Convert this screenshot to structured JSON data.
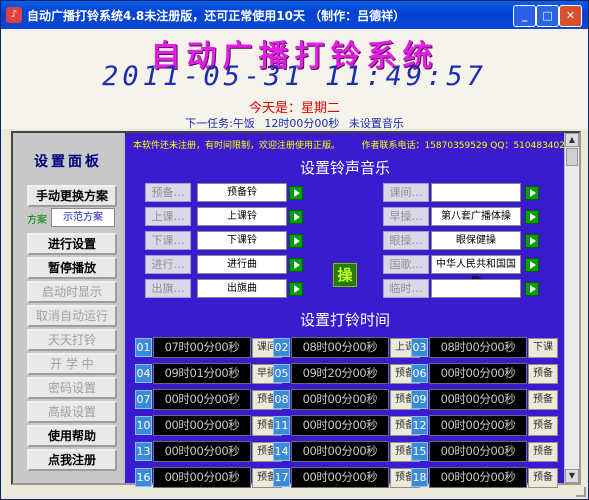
{
  "window": {
    "title": "自动广播打铃系统4.8未注册版，还可正常使用10天 （制作：吕德祥）",
    "min_icon": "minimize-icon",
    "max_icon": "maximize-icon",
    "close_icon": "close-icon"
  },
  "header": {
    "app_title": "自动广播打铃系统",
    "datetime": "2011-05-31  11:49:57",
    "today": "今天是：星期二",
    "next_task": "下一任务:午饭  12时00分00秒    未设置音乐"
  },
  "sidebar": {
    "title": "设置面板",
    "buttons": {
      "switch_scheme": "手动更换方案",
      "settings": "进行设置",
      "pause": "暂停播放",
      "autostart": "启动时显示",
      "cancel_auto": "取消自动运行",
      "daily": "天天打铃",
      "school_start": "开  学  中",
      "password": "密码设置",
      "advanced": "高级设置",
      "help": "使用帮助",
      "register": "点我注册"
    },
    "scheme_label": "方案",
    "scheme_value": "示范方案"
  },
  "panel": {
    "notice": "本软件还未注册，有时间限制，欢迎注册使用正版。",
    "contact": "作者联系电话：15870359529    QQ：510483402",
    "music_title": "设置铃声音乐",
    "bell_title": "设置打铃时间",
    "ops_label": "操",
    "music_left": [
      {
        "label": "预备…",
        "value": "预备铃"
      },
      {
        "label": "上课…",
        "value": "上课铃"
      },
      {
        "label": "下课…",
        "value": "下课铃"
      },
      {
        "label": "进行…",
        "value": "进行曲"
      },
      {
        "label": "出旗…",
        "value": "出旗曲"
      }
    ],
    "music_right": [
      {
        "label": "课间…",
        "value": ""
      },
      {
        "label": "早操…",
        "value": "第八套广播体操"
      },
      {
        "label": "眼操…",
        "value": "眼保健操"
      },
      {
        "label": "国歌…",
        "value": "中华人民共和国国歌"
      },
      {
        "label": "临时…",
        "value": ""
      }
    ],
    "bell_rows": [
      [
        {
          "n": "01",
          "t": "07时00分00秒",
          "a": "课间"
        },
        {
          "n": "02",
          "t": "08时00分00秒",
          "a": "上课"
        },
        {
          "n": "03",
          "t": "08时00分00秒",
          "a": "下课"
        }
      ],
      [
        {
          "n": "04",
          "t": "09时01分00秒",
          "a": "早操"
        },
        {
          "n": "05",
          "t": "09时20分00秒",
          "a": "预备"
        },
        {
          "n": "06",
          "t": "00时00分00秒",
          "a": "预备"
        }
      ],
      [
        {
          "n": "07",
          "t": "00时00分00秒",
          "a": "预备"
        },
        {
          "n": "08",
          "t": "00时00分00秒",
          "a": "预备"
        },
        {
          "n": "09",
          "t": "00时00分00秒",
          "a": "预备"
        }
      ],
      [
        {
          "n": "10",
          "t": "00时00分00秒",
          "a": "预备"
        },
        {
          "n": "11",
          "t": "00时00分00秒",
          "a": "预备"
        },
        {
          "n": "12",
          "t": "00时00分00秒",
          "a": "预备"
        }
      ],
      [
        {
          "n": "13",
          "t": "00时00分00秒",
          "a": "预备"
        },
        {
          "n": "14",
          "t": "00时00分00秒",
          "a": "预备"
        },
        {
          "n": "15",
          "t": "00时00分00秒",
          "a": "预备"
        }
      ],
      [
        {
          "n": "16",
          "t": "00时00分00秒",
          "a": "预备"
        },
        {
          "n": "17",
          "t": "00时00分00秒",
          "a": "预备"
        },
        {
          "n": "18",
          "t": "00时00分00秒",
          "a": "预备"
        }
      ]
    ]
  },
  "colors": {
    "panel_bg": "#3a1bd0",
    "title_magenta": "#e020e0",
    "clock_blue": "#1a2db4",
    "today_red": "#e00000"
  }
}
